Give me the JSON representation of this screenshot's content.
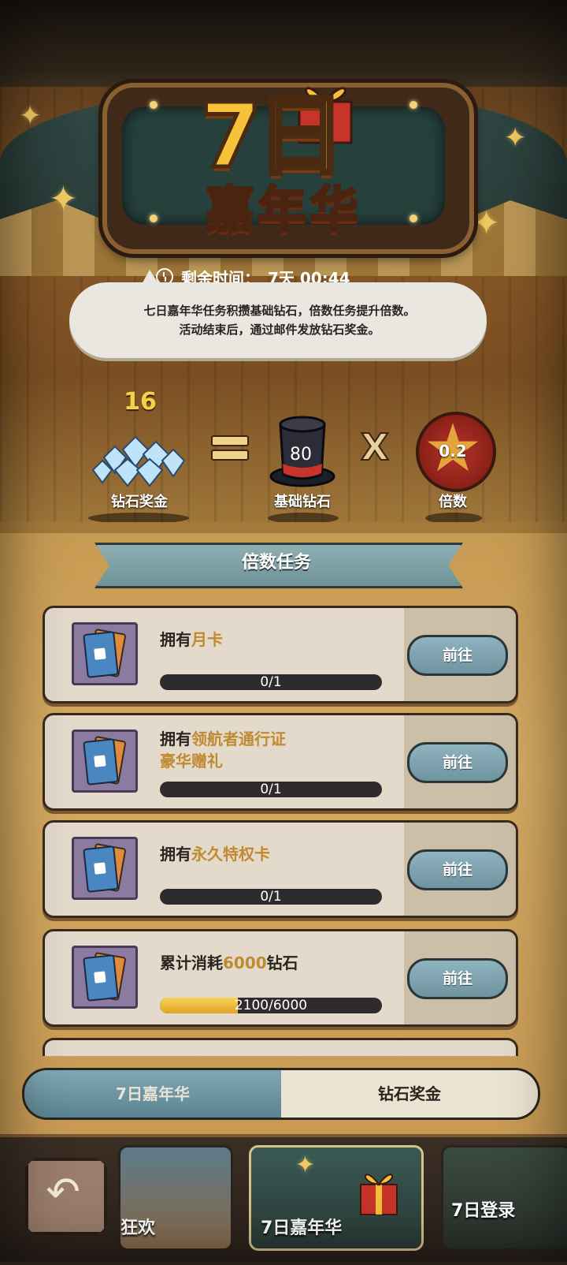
{
  "header": {
    "title_number": "7日",
    "title_sub": "嘉年华",
    "timer_label": "剩余时间：",
    "timer_value": "7天 00:44"
  },
  "description": {
    "line1": "七日嘉年华任务积攒基础钻石，倍数任务提升倍数。",
    "line2": "活动结束后，通过邮件发放钻石奖金。"
  },
  "equation": {
    "diamond_reward_value": "16",
    "diamond_reward_label": "钻石奖金",
    "equals": "=",
    "base_diamond_value": "80",
    "base_diamond_label": "基础钻石",
    "times": "X",
    "multiplier_value": "0.2",
    "multiplier_label": "倍数"
  },
  "section": {
    "title": "倍数任务"
  },
  "tasks": [
    {
      "prefix": "拥有",
      "highlight": "月卡",
      "suffix": "",
      "progress_text": "0/1",
      "progress": 0,
      "button": "前往"
    },
    {
      "prefix": "拥有",
      "highlight": "领航者通行证",
      "line2": "豪华赠礼",
      "suffix": "",
      "progress_text": "0/1",
      "progress": 0,
      "button": "前往"
    },
    {
      "prefix": "拥有",
      "highlight": "永久特权卡",
      "suffix": "",
      "progress_text": "0/1",
      "progress": 0,
      "button": "前往"
    },
    {
      "prefix": "累计消耗",
      "highlight": "6000",
      "suffix": "钻石",
      "progress_text": "2100/6000",
      "progress": 0.35,
      "button": "前往"
    }
  ],
  "tabs": {
    "active": "7日嘉年华",
    "inactive": "钻石奖金"
  },
  "nav": {
    "back_icon": "back-arrow-icon",
    "card1_label": "狂欢",
    "card2_label": "7日嘉年华",
    "card3_label": "7日登录"
  },
  "colors": {
    "accent_gold": "#f5c23a",
    "highlight_text": "#c08a30",
    "button_blue": "#7fa4b0",
    "progress_fill": "#f0c040"
  }
}
